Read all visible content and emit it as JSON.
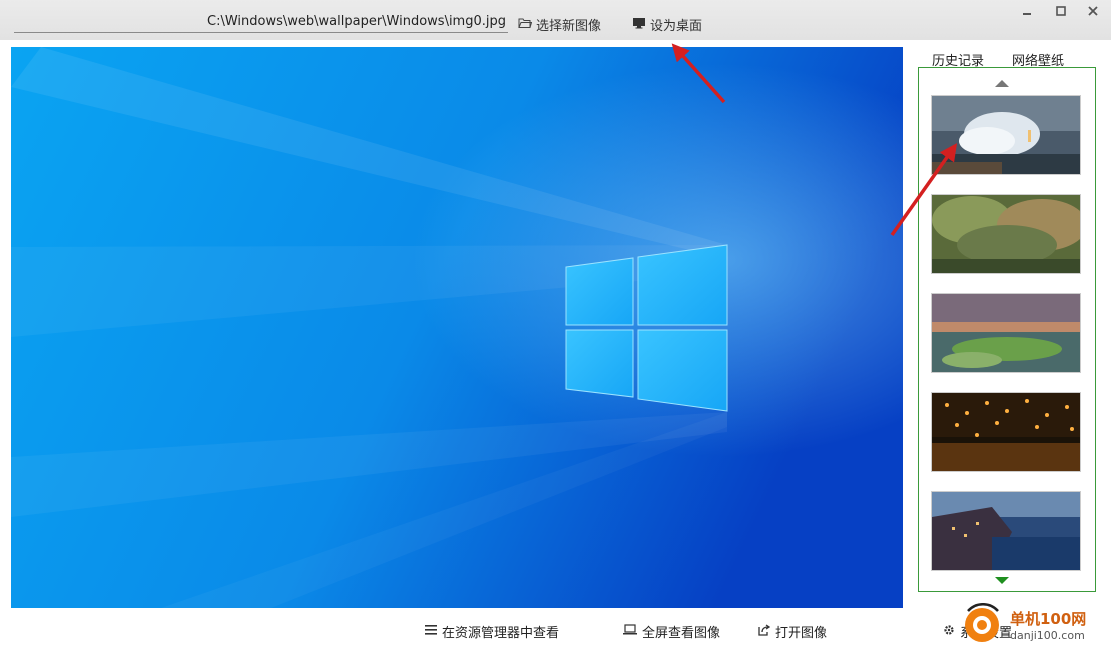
{
  "toolbar": {
    "path_value": "C:\\Windows\\web\\wallpaper\\Windows\\img0.jpg",
    "choose_image_label": "选择新图像",
    "set_desktop_label": "设为桌面"
  },
  "sidebar": {
    "tabs": [
      {
        "label": "历史记录"
      },
      {
        "label": "网络壁纸"
      }
    ],
    "thumbnails": [
      {
        "icon": "wave-lighthouse-thumbnail"
      },
      {
        "icon": "forest-thumbnail"
      },
      {
        "icon": "coast-sunset-thumbnail"
      },
      {
        "icon": "lanterns-thumbnail"
      },
      {
        "icon": "coastal-village-thumbnail"
      }
    ]
  },
  "bottom_bar": {
    "explorer_label": "在资源管理器中查看",
    "fullscreen_label": "全屏查看图像",
    "open_label": "打开图像",
    "settings_label": "系统设置"
  },
  "watermark": {
    "name": "单机100网",
    "url": "danji100.com"
  },
  "colors": {
    "panel_border": "#3a9a3a",
    "wallpaper_blue": "#0a7ae0",
    "annotation_arrow": "#d42020"
  }
}
